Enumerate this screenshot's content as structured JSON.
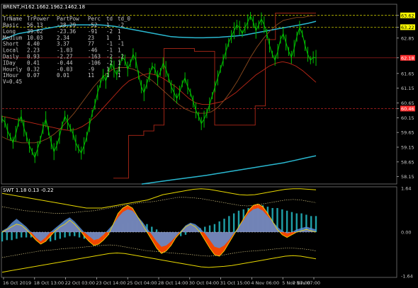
{
  "chart_data": {
    "type": "line",
    "symbol": "BRENT,H1",
    "ohlc": [
      "62.16",
      "62.19",
      "62.14",
      "62.18"
    ],
    "price_axis": [
      "63.62",
      "63.22",
      "62.85",
      "62.18",
      "61.65",
      "61.15",
      "60.65",
      "60.46",
      "60.15",
      "59.65",
      "59.15",
      "58.65",
      "58.15"
    ],
    "price_range": [
      57.95,
      63.95
    ],
    "price_levels": [
      {
        "label": "63.62",
        "value": 63.62,
        "color": "#ffff00",
        "style": "dashed"
      },
      {
        "label": "63.22",
        "value": 63.22,
        "color": "#ffff00",
        "style": "dashed"
      },
      {
        "label": "62.18",
        "value": 62.18,
        "color": "#ff3030",
        "style": "solid-tag"
      },
      {
        "label": "60.46",
        "value": 60.46,
        "color": "#ff3030",
        "style": "dashed"
      }
    ],
    "price_series": [
      60.1,
      60.0,
      59.7,
      59.5,
      59.3,
      59.6,
      60.0,
      60.2,
      59.8,
      59.5,
      59.2,
      59.0,
      58.8,
      59.1,
      59.4,
      59.8,
      60.1,
      59.7,
      59.3,
      59.0,
      59.2,
      59.5,
      59.9,
      60.2,
      60.0,
      59.8,
      59.6,
      59.3,
      59.1,
      58.95,
      59.2,
      59.5,
      59.9,
      60.3,
      60.6,
      61.0,
      61.3,
      61.6,
      61.4,
      61.7,
      62.0,
      61.8,
      61.6,
      61.9,
      62.2,
      62.1,
      61.8,
      62.0,
      62.3,
      62.1,
      61.6,
      61.2,
      61.0,
      61.3,
      61.6,
      61.9,
      61.8,
      61.5,
      61.7,
      62.0,
      61.8,
      61.5,
      61.2,
      61.0,
      60.8,
      61.0,
      61.3,
      61.5,
      61.2,
      61.0,
      60.7,
      60.4,
      60.2,
      59.95,
      60.1,
      60.3,
      60.6,
      60.9,
      61.2,
      61.5,
      61.8,
      62.1,
      62.4,
      62.7,
      62.9,
      63.1,
      63.3,
      63.2,
      63.0,
      63.2,
      63.4,
      63.6,
      63.4,
      63.1,
      63.3,
      63.5,
      63.3,
      63.0,
      62.6,
      62.3,
      62.1,
      62.4,
      62.8,
      63.0,
      62.7,
      62.4,
      62.2,
      62.5,
      62.9,
      63.2,
      63.0,
      62.6,
      62.3,
      62.1,
      62.2,
      62.18
    ],
    "ma_slow": [
      62.8,
      62.9,
      63.0,
      63.05,
      63.1,
      63.15,
      63.2,
      63.25,
      63.28,
      63.3,
      63.3,
      63.3,
      63.3,
      63.28,
      63.25,
      63.2,
      63.15,
      63.1,
      63.05,
      63.0,
      62.95,
      62.9,
      62.88,
      62.87,
      62.86,
      62.86,
      62.87,
      62.88,
      62.9,
      62.92,
      62.95,
      63.0,
      63.05,
      63.1,
      63.15,
      63.2,
      63.25,
      63.3,
      63.35,
      63.42
    ],
    "ma_long": [
      57.9,
      57.95,
      58.0,
      58.05,
      58.1,
      58.15,
      58.2,
      58.26,
      58.32,
      58.38,
      58.44,
      58.5,
      58.56,
      58.62,
      58.7,
      58.78,
      58.86
    ],
    "ma_mid": [
      60.2,
      60.15,
      60.1,
      60.05,
      60.0,
      59.95,
      59.9,
      59.85,
      59.8,
      59.75,
      59.72,
      59.75,
      59.85,
      60.0,
      60.2,
      60.45,
      60.7,
      60.95,
      61.2,
      61.4,
      61.5,
      61.6,
      61.65,
      61.6,
      61.5,
      61.35,
      61.2,
      61.0,
      60.8,
      60.65,
      60.6,
      60.6,
      60.65,
      60.7,
      60.85,
      61.0,
      61.2,
      61.4,
      61.6,
      61.75,
      61.9,
      62.0,
      62.05,
      62.0,
      61.9,
      61.75,
      61.55,
      61.35
    ],
    "ma_fast": [
      59.5,
      59.4,
      59.35,
      59.3,
      59.3,
      59.3,
      59.35,
      59.45,
      59.6,
      59.8,
      60.05,
      60.3,
      60.6,
      60.9,
      61.2,
      61.45,
      61.65,
      61.8,
      61.85,
      61.85,
      61.8,
      61.7,
      61.55,
      61.4,
      61.2,
      61.0,
      60.8,
      60.6,
      60.45,
      60.35,
      60.3,
      60.3,
      60.35,
      60.5,
      60.75,
      61.05,
      61.4,
      61.8,
      62.2,
      62.55,
      62.85,
      63.1,
      63.3,
      63.45,
      63.5,
      63.55,
      63.55,
      63.6,
      63.62
    ],
    "stair_series": [
      58.1,
      58.1,
      58.1,
      59.55,
      59.55,
      59.55,
      59.7,
      59.7,
      59.9,
      59.9,
      62.5,
      62.5,
      62.5,
      62.5,
      62.5,
      62.5,
      62.4,
      62.4,
      62.4,
      62.4,
      59.9,
      59.9,
      59.9,
      59.9,
      59.9,
      59.9,
      59.9,
      59.9,
      60.55,
      60.55,
      62.8,
      62.8,
      63.7,
      63.7,
      63.7,
      63.7,
      63.7,
      63.7,
      63.7,
      63.7
    ],
    "x_labels": [
      "16 Oct 2019",
      "18 Oct 13:00",
      "22 Oct 03:00",
      "23 Oct 14:00",
      "25 Oct 04:00",
      "28 Oct 14:00",
      "30 Oct 04:00",
      "31 Oct 15:00",
      "4 Nov 06:00",
      "5 Nov 17:00",
      "7 Nov 07:00"
    ],
    "stats_table": {
      "headers": [
        "TrName",
        "TrPower",
        "PartPow",
        "Perc",
        "td",
        "td_0"
      ],
      "rows": [
        [
          "Basic",
          "56.13",
          "-28.29",
          "-52",
          "1",
          "-2"
        ],
        [
          "Long",
          "39.62",
          "-23.36",
          "-91",
          "-2",
          "1"
        ],
        [
          "Medium",
          "10.03",
          "2.34",
          "23",
          "1",
          "1"
        ],
        [
          "Short",
          "4.40",
          "3.37",
          "77",
          "-1",
          "-1"
        ],
        [
          "Local",
          "2.23",
          "-1.03",
          "-46",
          "-1",
          "1"
        ],
        [
          "Daily",
          "0.93",
          "-2.27",
          "-163",
          "-2",
          "-2"
        ],
        [
          "IDay",
          "0.41",
          "-0.44",
          "-106",
          "-2",
          "1"
        ],
        [
          "Hourly",
          "0.32",
          "-0.03",
          "-9",
          "1",
          "1"
        ],
        [
          "IHour",
          "0.07",
          "0.01",
          "11",
          "1",
          "1"
        ]
      ],
      "footer": "V=0.45"
    },
    "indicator": {
      "name": "SWT 1.18 0.13 -0.22",
      "axis_labels": [
        "1.64",
        "0.00",
        "-1.64"
      ],
      "range": [
        -1.64,
        1.64
      ],
      "orange": [
        0.0,
        0.1,
        0.2,
        0.3,
        0.25,
        0.1,
        -0.1,
        -0.3,
        -0.45,
        -0.35,
        -0.15,
        0.05,
        0.2,
        0.3,
        0.45,
        0.3,
        0.1,
        -0.15,
        -0.35,
        -0.5,
        -0.45,
        -0.3,
        -0.1,
        0.3,
        0.7,
        0.9,
        1.0,
        0.9,
        0.6,
        0.3,
        0.0,
        -0.3,
        -0.6,
        -0.8,
        -0.7,
        -0.5,
        -0.2,
        0.0,
        0.2,
        0.3,
        0.2,
        0.0,
        -0.3,
        -0.6,
        -0.85,
        -0.9,
        -0.7,
        -0.4,
        -0.1,
        0.2,
        0.5,
        0.8,
        1.0,
        1.05,
        0.95,
        0.7,
        0.4,
        0.1,
        -0.1,
        -0.2,
        -0.1,
        0.0,
        0.05,
        0.1,
        0.05,
        0.0
      ],
      "blue": [
        0.05,
        0.15,
        0.35,
        0.5,
        0.35,
        0.2,
        0.0,
        -0.2,
        -0.35,
        -0.2,
        0.0,
        0.15,
        0.3,
        0.45,
        0.55,
        0.4,
        0.2,
        0.0,
        -0.15,
        -0.3,
        -0.25,
        -0.1,
        0.1,
        0.3,
        0.55,
        0.75,
        0.85,
        0.8,
        0.6,
        0.4,
        0.15,
        -0.1,
        -0.35,
        -0.55,
        -0.5,
        -0.35,
        -0.15,
        0.05,
        0.25,
        0.35,
        0.3,
        0.15,
        -0.05,
        -0.3,
        -0.55,
        -0.6,
        -0.5,
        -0.3,
        -0.05,
        0.2,
        0.45,
        0.7,
        0.85,
        0.9,
        0.8,
        0.6,
        0.4,
        0.2,
        0.05,
        -0.05,
        0.0,
        0.1,
        0.15,
        0.2,
        0.15,
        0.1
      ],
      "teal_histogram": [
        -0.35,
        -0.3,
        -0.3,
        -0.25,
        -0.2,
        -0.2,
        -0.2,
        -0.25,
        -0.3,
        -0.35,
        -0.35,
        -0.3,
        -0.25,
        -0.2,
        -0.15,
        -0.15,
        -0.2,
        -0.25,
        -0.3,
        -0.35,
        -0.3,
        -0.2,
        -0.1,
        0.05,
        0.2,
        0.3,
        0.35,
        0.4,
        0.4,
        0.35,
        0.3,
        0.2,
        0.1,
        0.0,
        -0.1,
        -0.15,
        -0.2,
        -0.15,
        -0.1,
        0.0,
        0.1,
        0.15,
        0.2,
        0.25,
        0.3,
        0.4,
        0.5,
        0.6,
        0.7,
        0.8,
        0.85,
        0.9,
        0.95,
        1.0,
        1.0,
        0.95,
        0.9,
        0.9,
        0.85,
        0.8,
        0.75,
        0.7,
        0.7,
        0.65,
        0.6,
        0.6
      ],
      "upper_band": [
        1.45,
        1.4,
        1.35,
        1.3,
        1.25,
        1.2,
        1.15,
        1.1,
        1.05,
        1.0,
        0.95,
        0.9,
        0.9,
        0.9,
        0.95,
        1.0,
        1.05,
        1.1,
        1.15,
        1.2,
        1.3,
        1.4,
        1.45,
        1.5,
        1.55,
        1.6,
        1.62,
        1.6,
        1.55,
        1.5,
        1.45,
        1.4,
        1.38,
        1.4,
        1.45,
        1.5,
        1.55,
        1.6,
        1.62,
        1.62,
        1.6,
        1.58
      ],
      "lower_band": [
        -1.5,
        -1.45,
        -1.4,
        -1.35,
        -1.3,
        -1.25,
        -1.2,
        -1.15,
        -1.1,
        -1.05,
        -1.0,
        -0.95,
        -0.9,
        -0.85,
        -0.8,
        -0.78,
        -0.8,
        -0.85,
        -0.9,
        -0.95,
        -1.0,
        -1.05,
        -1.1,
        -1.15,
        -1.2,
        -1.25,
        -1.3,
        -1.32,
        -1.3,
        -1.28,
        -1.25,
        -1.2,
        -1.15,
        -1.1,
        -1.05,
        -1.0,
        -0.95,
        -0.9,
        -0.88,
        -0.9,
        -0.95,
        -1.0
      ],
      "inner_upper": [
        0.95,
        0.9,
        0.85,
        0.8,
        0.78,
        0.75,
        0.72,
        0.7,
        0.7,
        0.72,
        0.75,
        0.78,
        0.8,
        0.85,
        0.9,
        0.95,
        1.0,
        1.05,
        1.1,
        1.12,
        1.15,
        1.2,
        1.25,
        1.3,
        1.3,
        1.28,
        1.25,
        1.2,
        1.15,
        1.1,
        1.05,
        1.0,
        0.98,
        1.0,
        1.05,
        1.1,
        1.15,
        1.2,
        1.22,
        1.2,
        1.15,
        1.1
      ],
      "inner_lower": [
        -0.95,
        -0.9,
        -0.85,
        -0.8,
        -0.75,
        -0.7,
        -0.68,
        -0.65,
        -0.62,
        -0.6,
        -0.58,
        -0.55,
        -0.52,
        -0.5,
        -0.48,
        -0.5,
        -0.55,
        -0.6,
        -0.65,
        -0.7,
        -0.72,
        -0.75,
        -0.78,
        -0.8,
        -0.82,
        -0.85,
        -0.88,
        -0.9,
        -0.88,
        -0.85,
        -0.8,
        -0.75,
        -0.72,
        -0.7,
        -0.68,
        -0.65,
        -0.62,
        -0.6,
        -0.6,
        -0.62,
        -0.65,
        -0.7
      ]
    }
  }
}
